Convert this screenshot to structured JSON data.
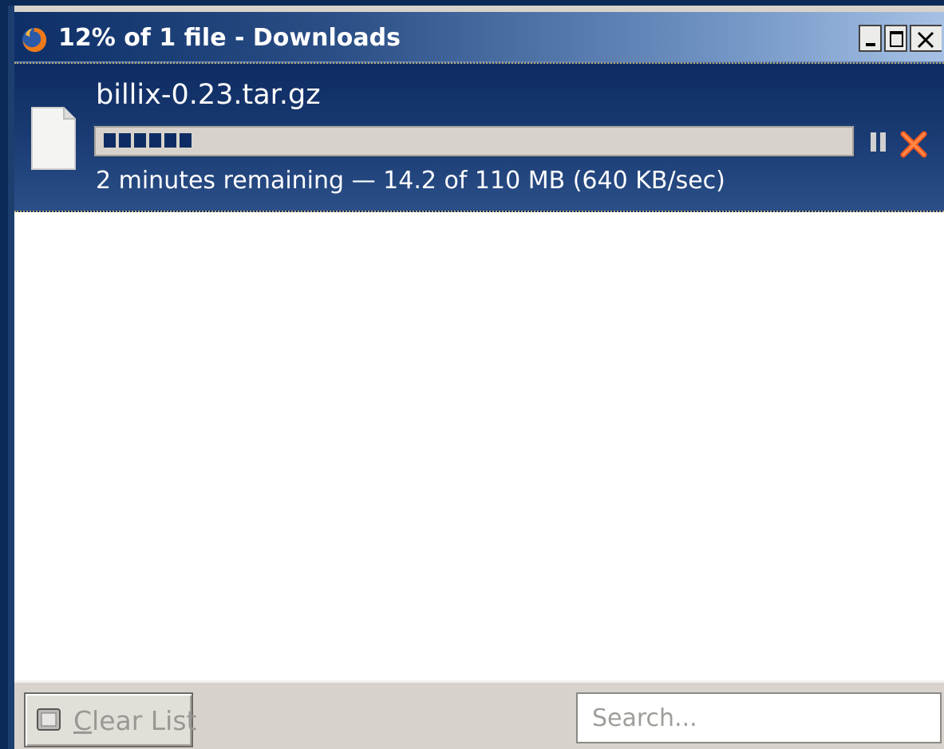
{
  "window": {
    "title": "12% of 1 file - Downloads",
    "controls": [
      "minimize",
      "maximize",
      "close"
    ]
  },
  "download": {
    "file_name": "billix-0.23.tar.gz",
    "progress_fraction": 0.12,
    "status": "2 minutes remaining — 14.2 of 110 MB (640 KB/sec)",
    "icons": {
      "file": "file-icon",
      "pause": "pause-icon",
      "cancel": "cancel-icon"
    },
    "cancel_color": "#ff5a1f"
  },
  "bottom": {
    "clear_label_first": "C",
    "clear_label_rest": "lear List",
    "search_placeholder": "Search..."
  },
  "colors": {
    "selection_bg": "#17376f",
    "progress_fill": "#0e2c63"
  }
}
